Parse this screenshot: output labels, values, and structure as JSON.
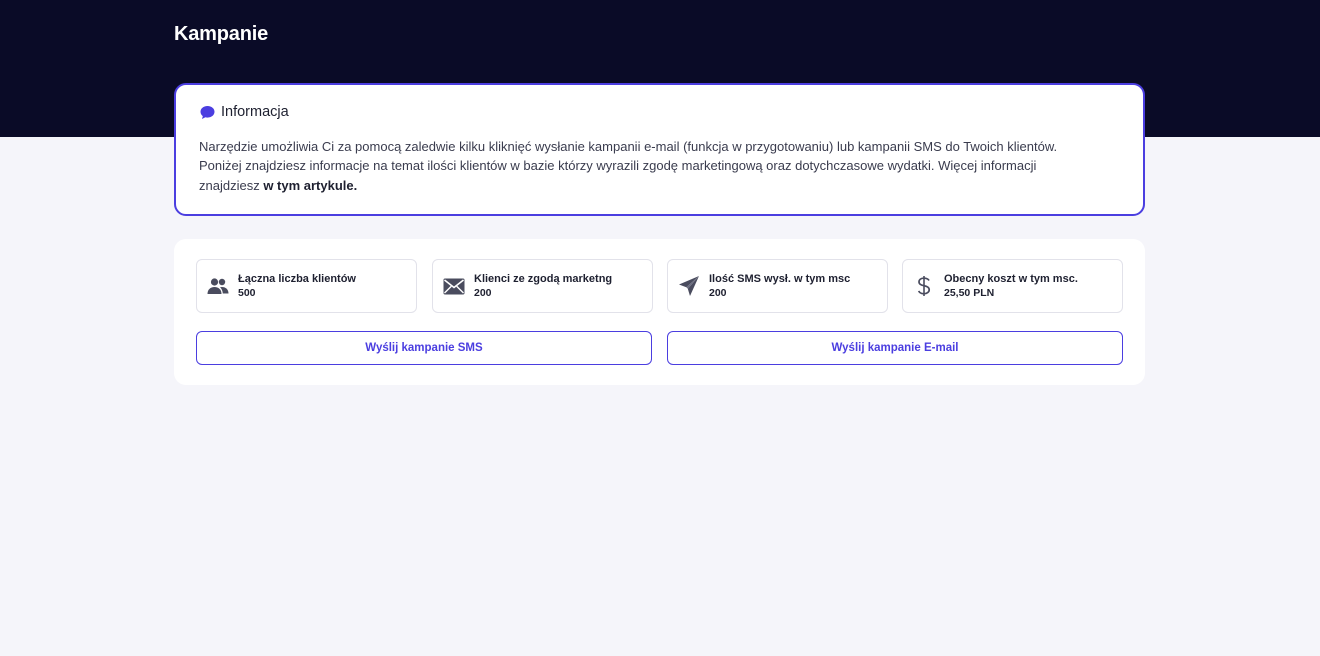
{
  "header": {
    "title": "Kampanie"
  },
  "info": {
    "icon": "chat-bubble-icon",
    "title": "Informacja",
    "text": "Narzędzie umożliwia Ci za pomocą zaledwie kilku kliknięć wysłanie kampanii e-mail (funkcja w przygotowaniu) lub kampanii SMS do Twoich klientów. Poniżej znajdziesz informacje na temat ilości klientów w bazie którzy wyrazili zgodę marketingową oraz dotychczasowe wydatki. Więcej informacji znajdziesz ",
    "link_text": "w tym artykule."
  },
  "stats": [
    {
      "icon": "users-icon",
      "label": "Łączna liczba klientów",
      "value": "500"
    },
    {
      "icon": "envelope-icon",
      "label": "Klienci ze zgodą marketng",
      "value": "200"
    },
    {
      "icon": "paper-plane-icon",
      "label": "Ilość SMS wysł. w tym msc",
      "value": "200"
    },
    {
      "icon": "dollar-icon",
      "label": "Obecny koszt w tym msc.",
      "value": "25,50 PLN"
    }
  ],
  "actions": {
    "sms_label": "Wyślij kampanie SMS",
    "email_label": "Wyślij kampanie E-mail"
  },
  "colors": {
    "header_bg": "#0a0b27",
    "accent": "#4b3ee0",
    "page_bg": "#f5f5fa",
    "icon_gray": "#4a4c5e"
  }
}
